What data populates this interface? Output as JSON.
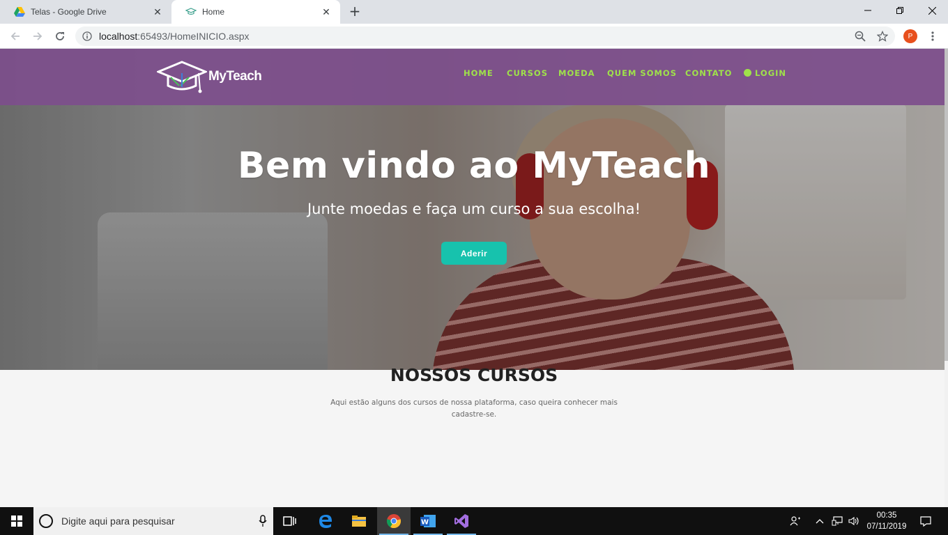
{
  "browser": {
    "tabs": [
      {
        "title": "Telas - Google Drive",
        "active": false
      },
      {
        "title": "Home",
        "active": true
      }
    ],
    "address": {
      "host": "localhost",
      "path": ":65493/HomeINICIO.aspx"
    },
    "profile_initial": "P"
  },
  "site": {
    "brand": "MyTeach",
    "nav": [
      "HOME",
      "CURSOS",
      "MOEDA",
      "QUEM SOMOS",
      "CONTATO",
      "LOGIN"
    ],
    "nav_color": "#9fe24a",
    "hero": {
      "title": "Bem vindo ao MyTeach",
      "subtitle": "Junte moedas e faça um curso a sua escolha!",
      "cta": "Aderir",
      "cta_color": "#17c2ad"
    },
    "courses": {
      "title": "NOSSOS CURSOS",
      "description": "Aqui estão alguns dos cursos de nossa plataforma, caso queira conhecer mais cadastre-se."
    }
  },
  "taskbar": {
    "search_placeholder": "Digite aqui para pesquisar",
    "time": "00:35",
    "date": "07/11/2019"
  }
}
